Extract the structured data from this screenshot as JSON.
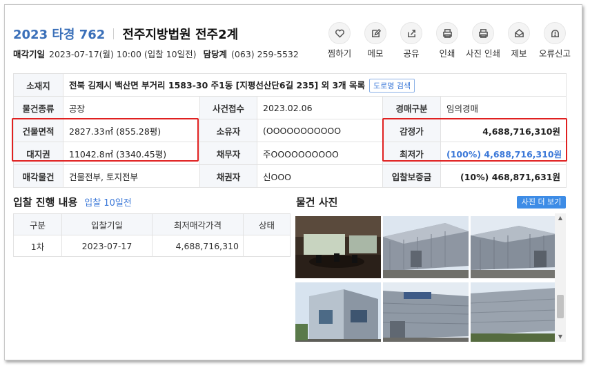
{
  "header": {
    "case_no": "2023 타경 762",
    "court": "전주지방법원 전주2계",
    "sale_date_label": "매각기일",
    "sale_date_value": "2023-07-17(월) 10:00 (입찰 10일전)",
    "dept_label": "담당계",
    "dept_value": "(063) 259-5532"
  },
  "actions": [
    {
      "label": "찜하기",
      "icon": "heart-icon"
    },
    {
      "label": "메모",
      "icon": "memo-icon"
    },
    {
      "label": "공유",
      "icon": "share-icon"
    },
    {
      "label": "인쇄",
      "icon": "print-icon"
    },
    {
      "label": "사진 인쇄",
      "icon": "photo-print-icon"
    },
    {
      "label": "제보",
      "icon": "report-icon"
    },
    {
      "label": "오류신고",
      "icon": "error-report-icon"
    }
  ],
  "info": {
    "location_label": "소재지",
    "location_value": "전북 김제시 백산면 부거리 1583-30 주1동 [지평선산단6길 235] 외 3개 목록",
    "road_btn": "도로명 검색",
    "type_label": "물건종류",
    "type_value": "공장",
    "received_label": "사건접수",
    "received_value": "2023.02.06",
    "sale_type_label": "경매구분",
    "sale_type_value": "임의경매",
    "bldg_area_label": "건물면적",
    "bldg_area_value": "2827.33㎡ (855.28평)",
    "owner_label": "소유자",
    "owner_value": "(OOOOOOOOOOO",
    "appraisal_label": "감정가",
    "appraisal_value": "4,688,716,310원",
    "land_label": "대지권",
    "land_value": "11042.8㎡ (3340.45평)",
    "debtor_label": "채무자",
    "debtor_value": "주OOOOOOOOOO",
    "min_price_label": "최저가",
    "min_price_value": "(100%) 4,688,716,310원",
    "sale_obj_label": "매각물건",
    "sale_obj_value": "건물전부, 토지전부",
    "creditor_label": "채권자",
    "creditor_value": "신OOO",
    "deposit_label": "입찰보증금",
    "deposit_value": "(10%) 468,871,631원"
  },
  "bid_section": {
    "title": "입찰 진행 내용",
    "subtitle": "입찰 10일전",
    "columns": [
      "구분",
      "입찰기일",
      "최저매각가격",
      "상태"
    ],
    "rows": [
      [
        "1차",
        "2023-07-17",
        "4,688,716,310",
        ""
      ]
    ]
  },
  "photo_section": {
    "title": "물건 사진",
    "more_btn": "사진 더 보기",
    "photos": [
      "office-interior",
      "warehouse-exterior",
      "warehouse-exterior",
      "building-corner",
      "warehouse-front",
      "warehouse-side"
    ]
  },
  "colors": {
    "accent": "#3b78d8",
    "highlight_box": "#e02020",
    "header_cell": "#f5f7fa"
  }
}
